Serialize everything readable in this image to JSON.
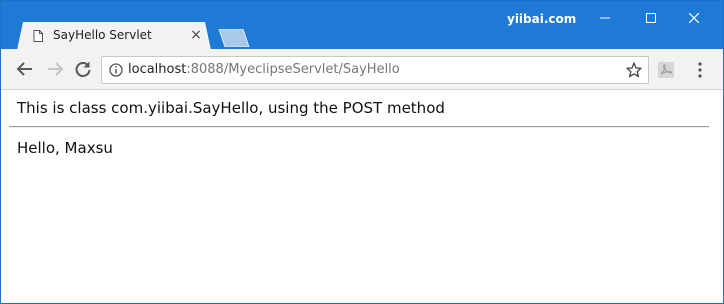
{
  "window": {
    "brand": "yiibai.com",
    "controls": {
      "minimize": "minimize",
      "maximize": "maximize",
      "close": "close"
    }
  },
  "tab": {
    "title": "SayHello Servlet",
    "close_glyph": "×"
  },
  "toolbar": {
    "url_host": "localhost",
    "url_rest": ":8088/MyeclipseServlet/SayHello"
  },
  "page": {
    "heading": "This is class com.yiibai.SayHello, using the POST method",
    "greeting": "Hello, Maxsu"
  },
  "colors": {
    "titlebar": "#1e7ad4",
    "tab": "#f2f2f2",
    "toolbar": "#f2f2f2"
  },
  "icons": [
    "document-icon",
    "back-arrow-icon",
    "forward-arrow-icon",
    "reload-icon",
    "info-icon",
    "star-icon",
    "pdf-extension-icon",
    "menu-dots-icon"
  ]
}
